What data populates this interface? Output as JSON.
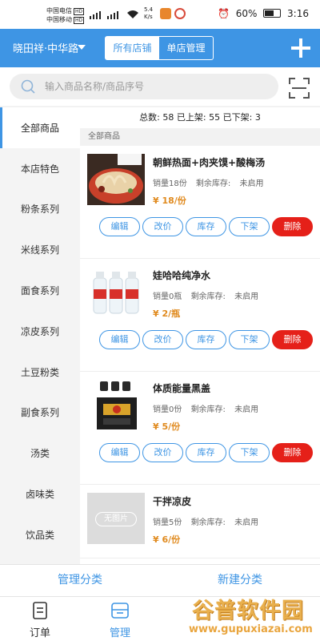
{
  "status_bar": {
    "carrier1": "中国电信",
    "carrier2": "中国移动",
    "hd": "HD",
    "net1": "4G",
    "net2": "4G",
    "speed_value": "5.4",
    "speed_unit": "K/s",
    "battery": "60%",
    "time": "3:16"
  },
  "header": {
    "store_name": "晓田祥·中华路",
    "seg_all": "所有店铺",
    "seg_single": "单店管理"
  },
  "search": {
    "placeholder": "输入商品名称/商品序号"
  },
  "sidebar": {
    "items": [
      {
        "label": "全部商品"
      },
      {
        "label": "本店特色"
      },
      {
        "label": "粉条系列"
      },
      {
        "label": "米线系列"
      },
      {
        "label": "面食系列"
      },
      {
        "label": "凉皮系列"
      },
      {
        "label": "土豆粉类"
      },
      {
        "label": "副食系列"
      },
      {
        "label": "汤类"
      },
      {
        "label": "卤味类"
      },
      {
        "label": "饮品类"
      }
    ]
  },
  "summary": {
    "total_label": "总数:",
    "total": "58",
    "on_label": "已上架:",
    "on": "55",
    "off_label": "已下架:",
    "off": "3"
  },
  "category_label": "全部商品",
  "products": [
    {
      "name": "朝鲜热面+肉夹馍+酸梅汤",
      "sales": "销量18份",
      "stock": "剩余库存:",
      "stock_value": "未启用",
      "price": "¥ 18/份"
    },
    {
      "name": "娃哈哈纯净水",
      "sales": "销量0瓶",
      "stock": "剩余库存:",
      "stock_value": "未启用",
      "price": "¥ 2/瓶"
    },
    {
      "name": "体质能量黑盖",
      "sales": "销量0份",
      "stock": "剩余库存:",
      "stock_value": "未启用",
      "price": "¥ 5/份"
    },
    {
      "name": "干拌凉皮",
      "sales": "销量5份",
      "stock": "剩余库存:",
      "stock_value": "未启用",
      "price": "¥ 6/份",
      "no_image": "无图片"
    }
  ],
  "buttons": {
    "edit": "编辑",
    "price": "改价",
    "stock": "库存",
    "offshelf": "下架",
    "delete": "删除"
  },
  "category_actions": {
    "manage": "管理分类",
    "create": "新建分类"
  },
  "tabbar": {
    "orders": "订单",
    "manage": "管理"
  },
  "watermark": {
    "title": "谷普软件园",
    "url": "www.gupuxiazai.com"
  },
  "colors": {
    "primary": "#3e95e4",
    "delete": "#e52019",
    "price": "#e08a1e"
  }
}
